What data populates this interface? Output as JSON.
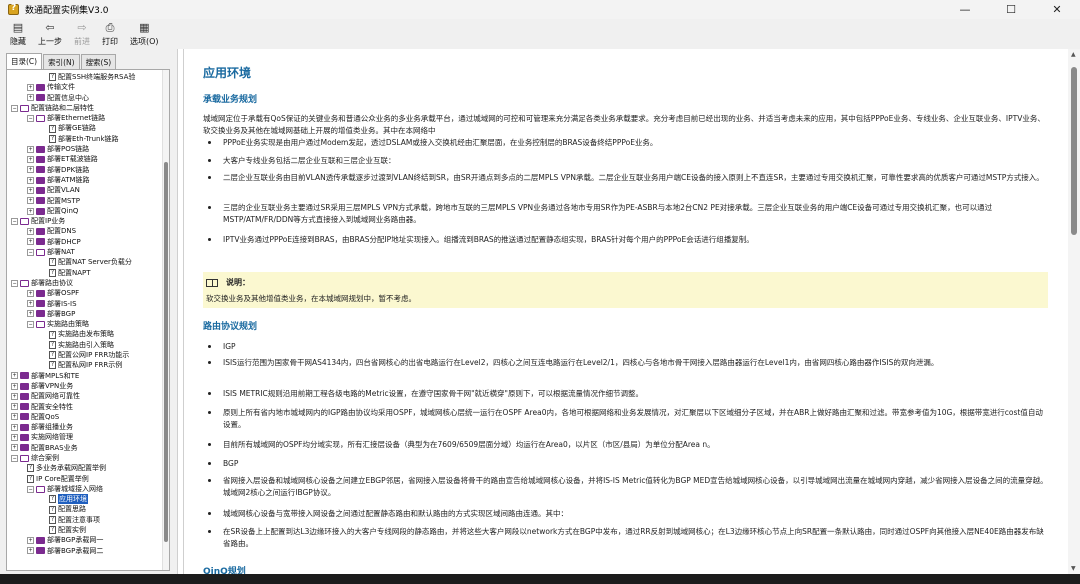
{
  "window": {
    "title": "数通配置实例集V3.0"
  },
  "toolbar": {
    "hide": "隐藏",
    "back": "上一步",
    "forward": "前进",
    "print": "打印",
    "options": "选项(O)"
  },
  "tabs": [
    "目录(C)",
    "索引(N)",
    "搜索(S)"
  ],
  "tree": [
    {
      "label": "配置SSH终端服务RSA验",
      "type": "page",
      "level": 4
    },
    {
      "label": "传输文件",
      "type": "book",
      "level": 2
    },
    {
      "label": "配置信息中心",
      "type": "book",
      "level": 2
    },
    {
      "label": "配置链路和二层特性",
      "type": "openbook",
      "level": 1
    },
    {
      "label": "部署Ethernet链路",
      "type": "openbook",
      "level": 2
    },
    {
      "label": "部署GE链路",
      "type": "page",
      "level": 3
    },
    {
      "label": "部署Eth-Trunk链路",
      "type": "page",
      "level": 3
    },
    {
      "label": "部署POS链路",
      "type": "book",
      "level": 2
    },
    {
      "label": "部署ET载波链路",
      "type": "book",
      "level": 2
    },
    {
      "label": "部署DPK链路",
      "type": "book",
      "level": 2
    },
    {
      "label": "部署ATM链路",
      "type": "book",
      "level": 2
    },
    {
      "label": "配置VLAN",
      "type": "book",
      "level": 2
    },
    {
      "label": "配置MSTP",
      "type": "book",
      "level": 2
    },
    {
      "label": "配置QinQ",
      "type": "book",
      "level": 2
    },
    {
      "label": "配置IP业务",
      "type": "openbook",
      "level": 1
    },
    {
      "label": "配置DNS",
      "type": "book",
      "level": 2
    },
    {
      "label": "部署DHCP",
      "type": "book",
      "level": 2
    },
    {
      "label": "部署NAT",
      "type": "openbook",
      "level": 2
    },
    {
      "label": "配置NAT Server负载分",
      "type": "page",
      "level": 3
    },
    {
      "label": "配置NAPT",
      "type": "page",
      "level": 3
    },
    {
      "label": "部署路由协议",
      "type": "openbook",
      "level": 1
    },
    {
      "label": "部署OSPF",
      "type": "book",
      "level": 2
    },
    {
      "label": "部署IS-IS",
      "type": "book",
      "level": 2
    },
    {
      "label": "部署BGP",
      "type": "book",
      "level": 2
    },
    {
      "label": "实施路由策略",
      "type": "openbook",
      "level": 2
    },
    {
      "label": "实施路由发布策略",
      "type": "page",
      "level": 3
    },
    {
      "label": "实施路由引入策略",
      "type": "page",
      "level": 3
    },
    {
      "label": "配置公网IP FRR功能示",
      "type": "page",
      "level": 3
    },
    {
      "label": "配置私网IP FRR示例",
      "type": "page",
      "level": 3
    },
    {
      "label": "部署MPLS和TE",
      "type": "book",
      "level": 1
    },
    {
      "label": "部署VPN业务",
      "type": "book",
      "level": 1
    },
    {
      "label": "配置网络可靠性",
      "type": "book",
      "level": 1
    },
    {
      "label": "配置安全特性",
      "type": "book",
      "level": 1
    },
    {
      "label": "配置QoS",
      "type": "book",
      "level": 1
    },
    {
      "label": "部署组播业务",
      "type": "book",
      "level": 1
    },
    {
      "label": "实施网络管理",
      "type": "book",
      "level": 1
    },
    {
      "label": "配置BRAS业务",
      "type": "book",
      "level": 1
    },
    {
      "label": "综合案例",
      "type": "openbook",
      "level": 1
    },
    {
      "label": "多业务承载网配置举例",
      "type": "page",
      "level": 2
    },
    {
      "label": "IP Core配置举例",
      "type": "page",
      "level": 2
    },
    {
      "label": "部署城域接入网络",
      "type": "openbook",
      "level": 2
    },
    {
      "label": "应用环境",
      "type": "page",
      "level": 3,
      "selected": true
    },
    {
      "label": "配置思路",
      "type": "page",
      "level": 3
    },
    {
      "label": "配置注意事项",
      "type": "page",
      "level": 3
    },
    {
      "label": "配置实例",
      "type": "page",
      "level": 3
    },
    {
      "label": "部署BGP承载网一",
      "type": "book",
      "level": 2
    },
    {
      "label": "部署BGP承载网二",
      "type": "book",
      "level": 2
    }
  ],
  "content": {
    "title": "应用环境",
    "section1": "承载业务规划",
    "intro": "城域网定位于承载有QoS保证的关键业务和普通公众业务的多业务承载平台，通过城域网的可控和可管理来充分满足各类业务承载要求。充分考虑目前已经出现的业务、并适当考虑未来的应用，其中包括PPPoE业务、专线业务、企业互联业务、IPTV业务、软交换业务及其他在城域网基础上开展的增值类业务。其中在本网络中",
    "bullets1": [
      "PPPoE业务实现是由用户通过Modem发起，透过DSLAM或接入交换机经由汇聚层面，在业务控制层的BRAS设备终结PPPoE业务。",
      "大客户专线业务包括二层企业互联和三层企业互联：",
      "二层企业互联业务由目前VLAN透传承载逐步过渡到VLAN终结到SR，由SR开通点到多点的二层MPLS VPN承载。二层企业互联业务用户端CE设备的接入原则上不直连SR，主要通过专用交换机汇聚，可靠性要求高的优质客户可通过MSTP方式接入。",
      "三层的企业互联业务主要通过SR采用三层MPLS VPN方式承载，跨地市互联的三层MPLS VPN业务通过各地市专用SR作为PE-ASBR与本地2台CN2 PE对接承载。三层企业互联业务的用户端CE设备可通过专用交换机汇聚，也可以通过MSTP/ATM/FR/DDN等方式直接接入到城域网业务路由器。",
      "IPTV业务通过PPPoE连接到BRAS，由BRAS分配IP地址实现接入。组播流到BRAS的推送通过配置静态组实现，BRAS针对每个用户的PPPoE会话进行组播复制。"
    ],
    "note_title": "说明：",
    "note_body": "软交换业务及其他增值类业务，在本城域网规划中，暂不考虑。",
    "section2": "路由协议规划",
    "bullets2": [
      "IGP",
      "ISIS运行范围为国家骨干网AS4134内，四台省网核心的出省电路运行在Level2，四核心之间互连电路运行在Level2/1，四核心与各地市骨干网接入层路由器运行在Level1内，由省网四核心路由器作ISIS的双向泄漏。",
      "ISIS METRIC规则沿用前期工程各级电路的Metric设置，在遵守国家骨干网\"就近横穿\"原则下，可以根据流量情况作细节调整。",
      "原则上所有省内地市城域网内的IGP路由协议均采用OSPF，城域网核心层统一运行在OSPF Area0内，各地可根据网络和业务发展情况，对汇聚层以下区域细分子区域，并在ABR上做好路由汇聚和过滤。带宽参考值为10G，根据带宽进行cost值自动设置。",
      "目前所有城域网的OSPF均分域实现，所有汇接层设备（典型为在7609/6509层面分域）均运行在Area0，以片区（市区/县局）为单位分配Area n。",
      "BGP",
      "省网接入层设备和城域网核心设备之间建立EBGP邻居，省网接入层设备将骨干的路由宣告给城域网核心设备，并将IS-IS Metric值转化为BGP MED宣告给城域网核心设备，以引导城域网出流量在城域网内穿越，减少省网接入层设备之间的流量穿越。城域网2核心之间运行IBGP协议。",
      "城域网核心设备与宽带接入网设备之间通过配置静态路由和默认路由的方式实现区域间路由连通。其中：",
      "在SR设备上上配置到达L3边缘环接入的大客户专线网段的静态路由，并将这些大客户网段以network方式在BGP中发布，通过RR反射到城域网核心；在L3边缘环核心节点上向SR配置一条默认路由，同时通过OSPF向其他接入层NE40E路由器发布缺省路由。"
    ],
    "section3": "QinQ规划"
  }
}
